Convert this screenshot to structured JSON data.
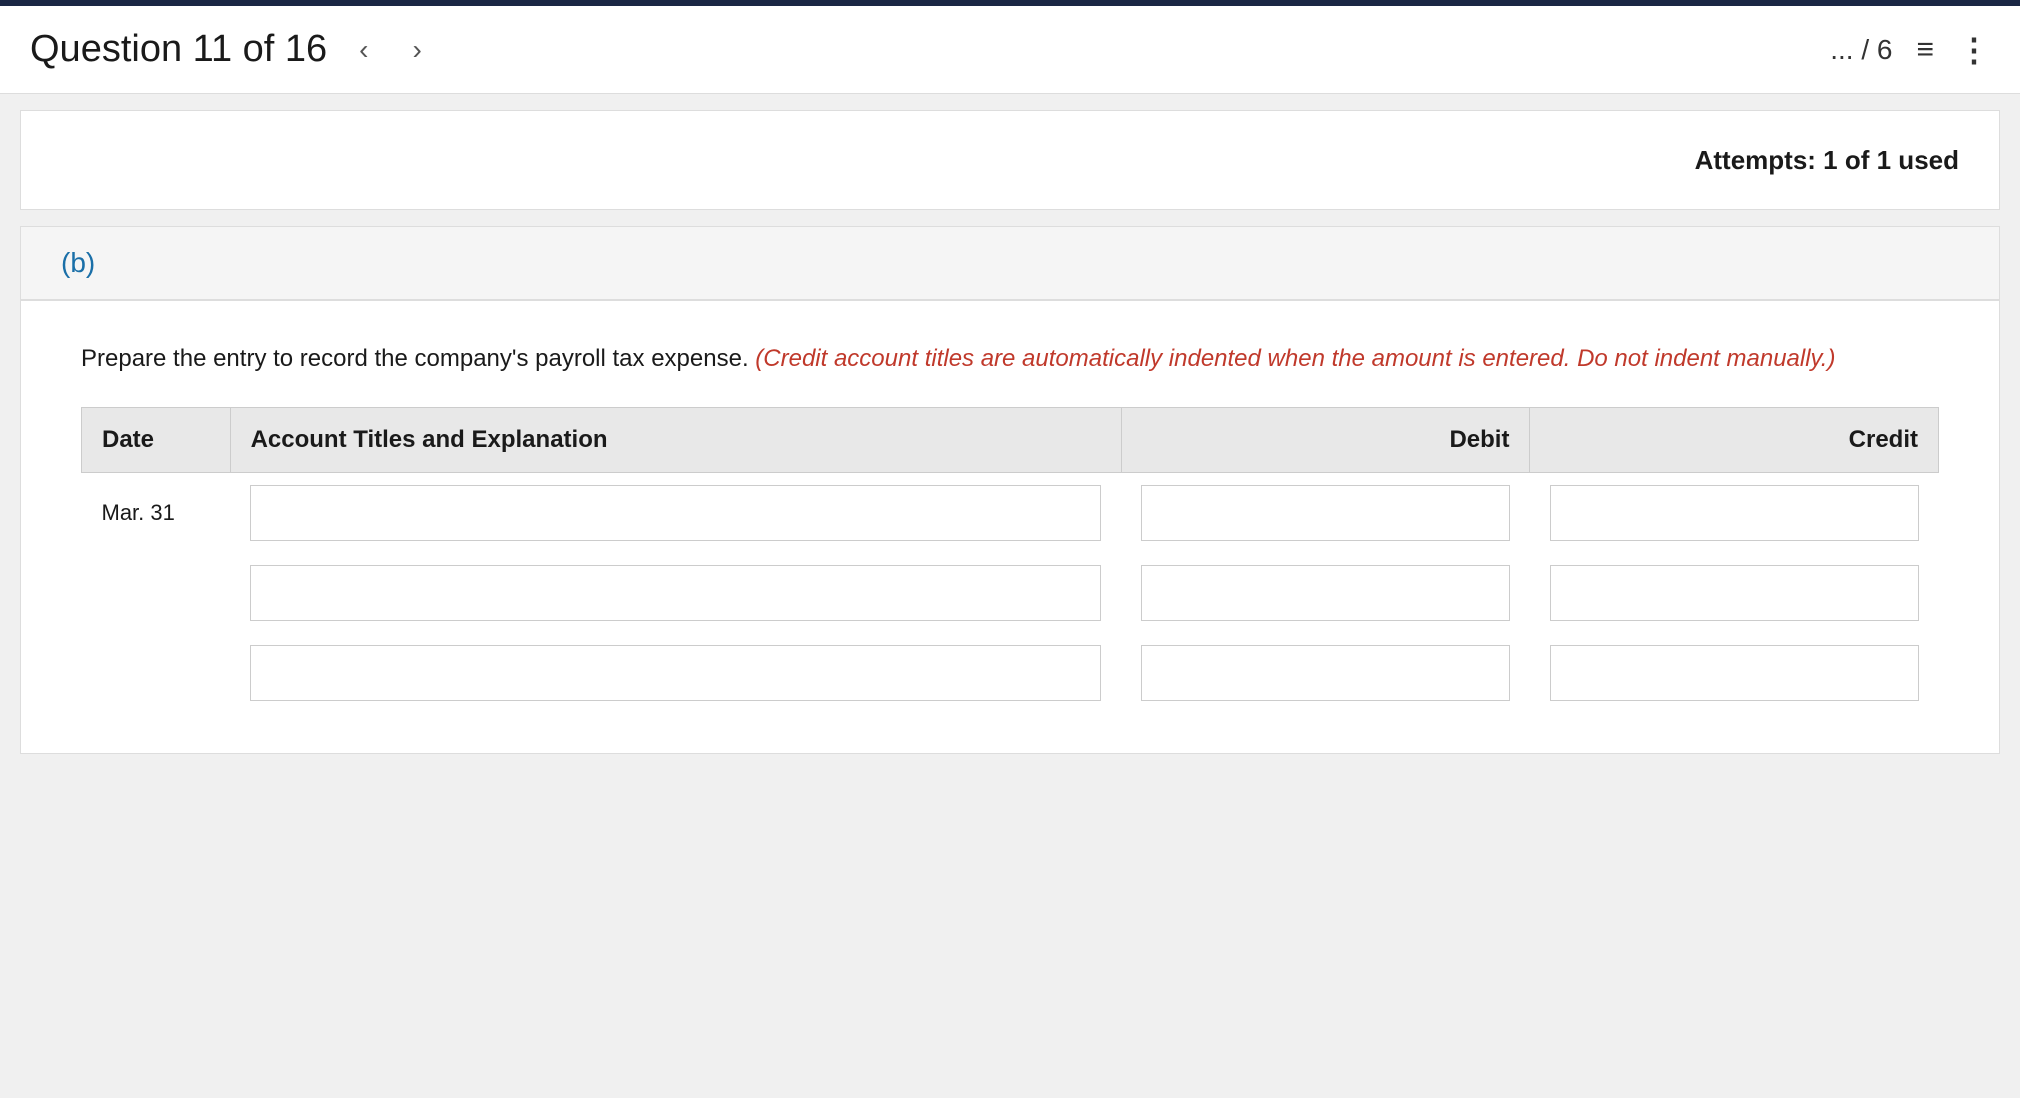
{
  "header": {
    "question_title": "Question 11 of 16",
    "nav_prev": "‹",
    "nav_next": "›",
    "page_indicator": "... / 6",
    "list_icon": "≡",
    "more_icon": "⋮"
  },
  "attempts": {
    "text": "Attempts: 1 of 1 used"
  },
  "part": {
    "label": "(b)"
  },
  "content": {
    "instruction_plain": "Prepare the entry to record the company's payroll tax expense.",
    "instruction_red": "(Credit account titles are automatically indented when the amount is entered. Do not indent manually.)",
    "table": {
      "headers": {
        "date": "Date",
        "account": "Account Titles and Explanation",
        "debit": "Debit",
        "credit": "Credit"
      },
      "rows": [
        {
          "date": "Mar. 31",
          "account": "",
          "debit": "",
          "credit": ""
        },
        {
          "date": "",
          "account": "",
          "debit": "",
          "credit": ""
        },
        {
          "date": "",
          "account": "",
          "debit": "",
          "credit": ""
        }
      ]
    }
  }
}
